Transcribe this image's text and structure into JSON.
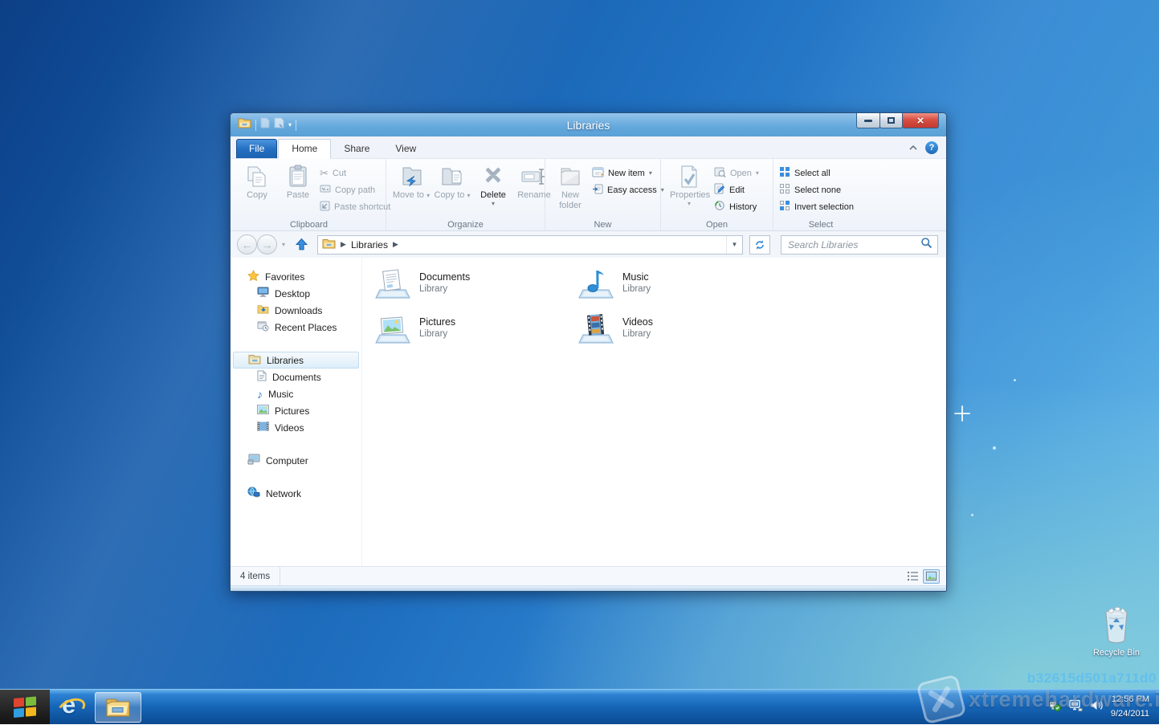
{
  "window": {
    "title": "Libraries",
    "tabs": {
      "file": "File",
      "home": "Home",
      "share": "Share",
      "view": "View"
    },
    "ribbon": {
      "clipboard": {
        "label": "Clipboard",
        "copy": "Copy",
        "paste": "Paste",
        "cut": "Cut",
        "copy_path": "Copy path",
        "paste_shortcut": "Paste shortcut"
      },
      "organize": {
        "label": "Organize",
        "move_to": "Move to",
        "copy_to": "Copy to",
        "delete": "Delete",
        "rename": "Rename"
      },
      "new": {
        "label": "New",
        "new_folder": "New folder",
        "new_item": "New item",
        "easy_access": "Easy access"
      },
      "open": {
        "label": "Open",
        "properties": "Properties",
        "open": "Open",
        "edit": "Edit",
        "history": "History"
      },
      "select": {
        "label": "Select",
        "select_all": "Select all",
        "select_none": "Select none",
        "invert_selection": "Invert selection"
      }
    },
    "address": {
      "path": "Libraries",
      "search_placeholder": "Search Libraries"
    },
    "sidebar": {
      "favorites": {
        "label": "Favorites",
        "items": [
          "Desktop",
          "Downloads",
          "Recent Places"
        ]
      },
      "libraries": {
        "label": "Libraries",
        "items": [
          "Documents",
          "Music",
          "Pictures",
          "Videos"
        ]
      },
      "computer": {
        "label": "Computer"
      },
      "network": {
        "label": "Network"
      }
    },
    "content": {
      "items": [
        {
          "name": "Documents",
          "type": "Library"
        },
        {
          "name": "Music",
          "type": "Library"
        },
        {
          "name": "Pictures",
          "type": "Library"
        },
        {
          "name": "Videos",
          "type": "Library"
        }
      ]
    },
    "statusbar": {
      "count": "4 items"
    }
  },
  "desktop": {
    "recycle_bin_label": "Recycle Bin",
    "watermark_build_id": "b32615d501a711d0",
    "watermark_site": "xtremehardware.it"
  },
  "taskbar": {
    "time": "12:56 PM",
    "date": "9/24/2011"
  },
  "colors": {
    "titlebar_blue": "#63a8dc",
    "taskbar_blue": "#1766b8",
    "file_tab_blue": "#2570c2",
    "close_red": "#d84f43",
    "selection_highlight": "#d6e9f9",
    "accent_blue": "#2f86d8",
    "desktop_blue": "#1f6fc0"
  }
}
